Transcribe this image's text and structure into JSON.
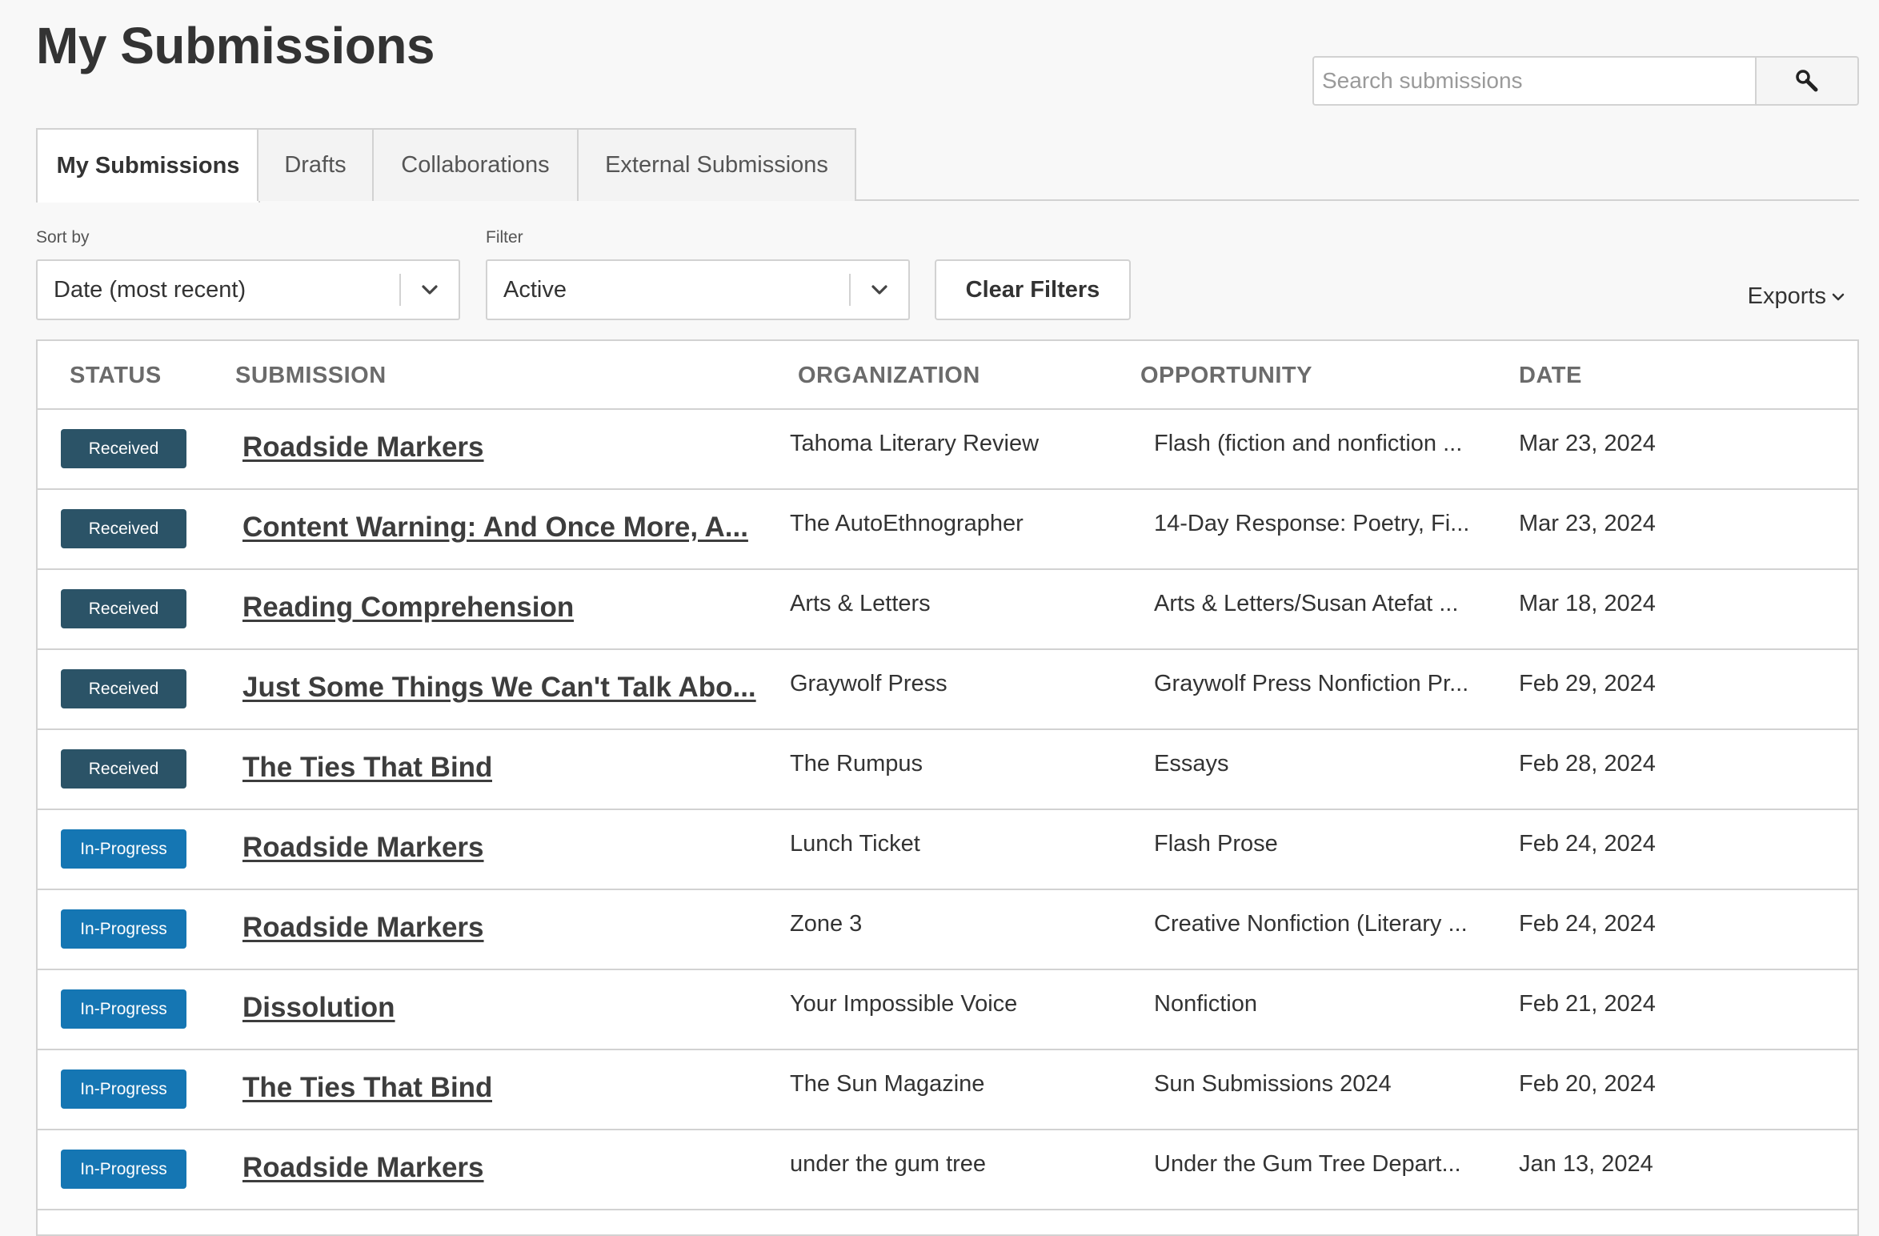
{
  "page": {
    "title": "My Submissions"
  },
  "search": {
    "placeholder": "Search submissions",
    "value": "",
    "icon": "search-icon"
  },
  "tabs": [
    {
      "label": "My Submissions",
      "active": true
    },
    {
      "label": "Drafts",
      "active": false
    },
    {
      "label": "Collaborations",
      "active": false
    },
    {
      "label": "External Submissions",
      "active": false
    }
  ],
  "controls": {
    "sort_label": "Sort by",
    "sort_value": "Date (most recent)",
    "filter_label": "Filter",
    "filter_value": "Active",
    "clear_label": "Clear Filters",
    "exports_label": "Exports"
  },
  "table": {
    "headers": {
      "status": "STATUS",
      "submission": "SUBMISSION",
      "organization": "ORGANIZATION",
      "opportunity": "OPPORTUNITY",
      "date": "DATE"
    },
    "rows": [
      {
        "status": "Received",
        "title": "Roadside Markers",
        "organization": "Tahoma Literary Review",
        "opportunity": "Flash (fiction and nonfiction ...",
        "date": "Mar 23, 2024"
      },
      {
        "status": "Received",
        "title": "Content Warning: And Once More, A...",
        "organization": "The AutoEthnographer",
        "opportunity": "14-Day Response: Poetry, Fi...",
        "date": "Mar 23, 2024"
      },
      {
        "status": "Received",
        "title": "Reading Comprehension",
        "organization": "Arts & Letters",
        "opportunity": "Arts & Letters/Susan Atefat ...",
        "date": "Mar 18, 2024"
      },
      {
        "status": "Received",
        "title": "Just Some Things We Can't Talk Abo...",
        "organization": "Graywolf Press",
        "opportunity": "Graywolf Press Nonfiction Pr...",
        "date": "Feb 29, 2024"
      },
      {
        "status": "Received",
        "title": "The Ties That Bind",
        "organization": "The Rumpus",
        "opportunity": "Essays",
        "date": "Feb 28, 2024"
      },
      {
        "status": "In-Progress",
        "title": "Roadside Markers",
        "organization": "Lunch Ticket",
        "opportunity": "Flash Prose",
        "date": "Feb 24, 2024"
      },
      {
        "status": "In-Progress",
        "title": "Roadside Markers",
        "organization": "Zone 3",
        "opportunity": "Creative Nonfiction (Literary ...",
        "date": "Feb 24, 2024"
      },
      {
        "status": "In-Progress",
        "title": "Dissolution",
        "organization": "Your Impossible Voice",
        "opportunity": "Nonfiction",
        "date": "Feb 21, 2024"
      },
      {
        "status": "In-Progress",
        "title": "The Ties That Bind",
        "organization": "The Sun Magazine",
        "opportunity": "Sun Submissions 2024",
        "date": "Feb 20, 2024"
      },
      {
        "status": "In-Progress",
        "title": "Roadside Markers",
        "organization": "under the gum tree",
        "opportunity": "Under the Gum Tree Depart...",
        "date": "Jan 13, 2024"
      }
    ]
  },
  "colors": {
    "received_badge": "#2b5367",
    "in_progress_badge": "#1576b3",
    "background": "#f8f8f8",
    "border": "#d2d2d2"
  }
}
